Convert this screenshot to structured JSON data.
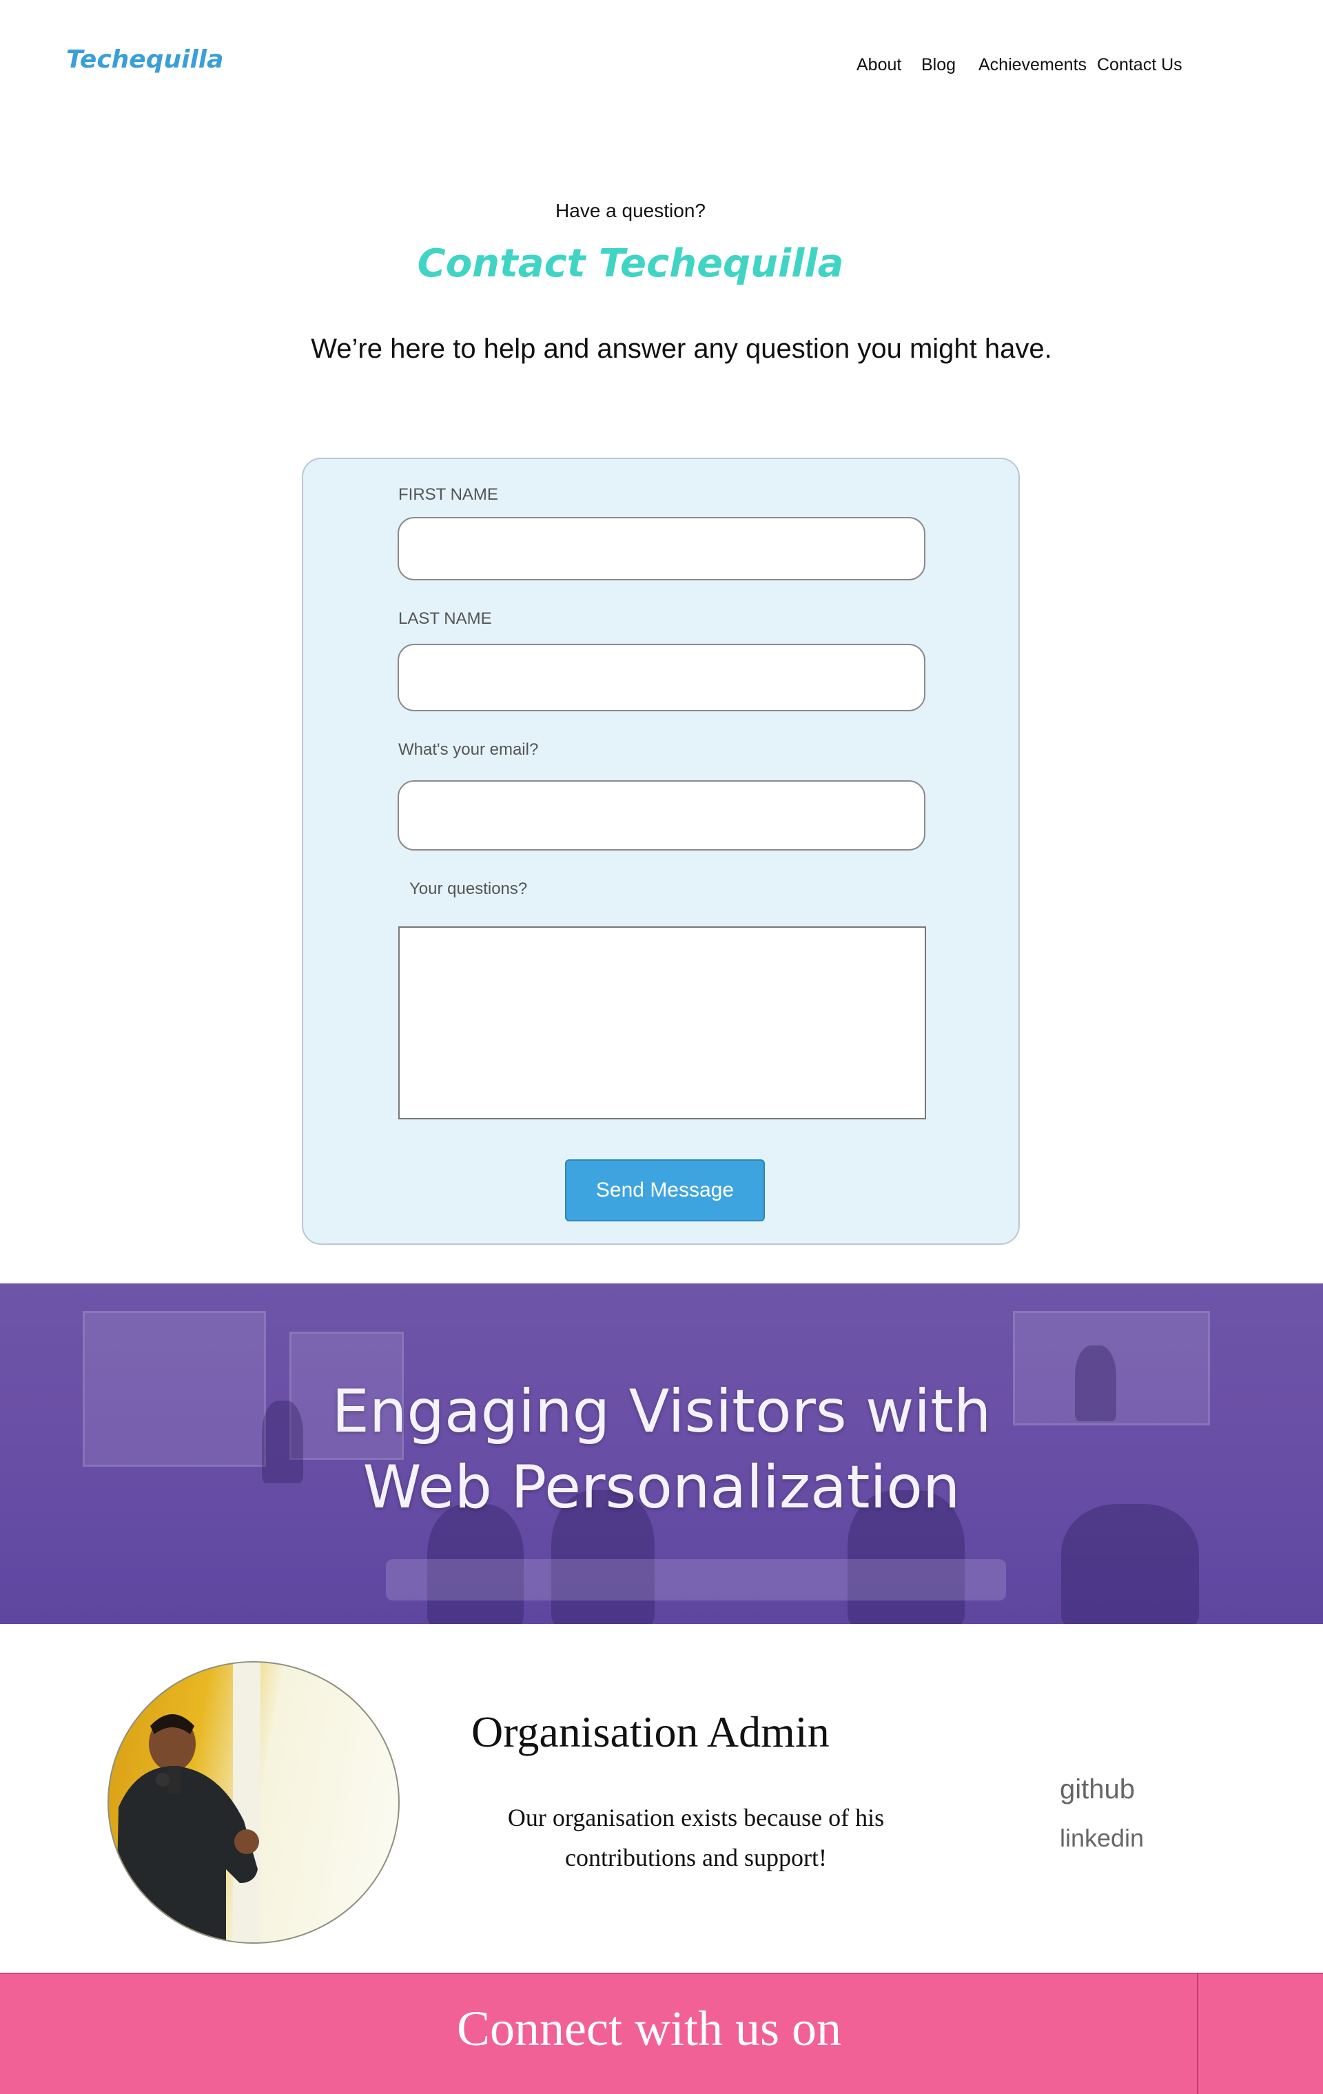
{
  "brand": "Techequilla",
  "nav": {
    "items": [
      "About",
      "Blog",
      "Achievements",
      "Contact Us"
    ]
  },
  "hero": {
    "eyebrow": "Have a question?",
    "title": "Contact Techequilla",
    "subtitle": "We’re here to help and answer any question you might have."
  },
  "form": {
    "first_name_label": "FIRST NAME",
    "first_name_value": "",
    "last_name_label": "LAST NAME",
    "last_name_value": "",
    "email_label": "What's your email?",
    "email_value": "",
    "questions_label": "Your questions?",
    "questions_value": "",
    "send_label": "Send Message"
  },
  "banner": {
    "line1": "Engaging Visitors with",
    "line2": "Web Personalization"
  },
  "admin": {
    "title": "Organisation Admin",
    "description": "Our organisation exists because of his contributions and support!",
    "links": [
      "github",
      "linkedin"
    ]
  },
  "footer": {
    "text": "Connect with us on"
  },
  "colors": {
    "brand": "#3a9fd8",
    "title": "#3fd4c4",
    "card_bg": "#e4f3fa",
    "button": "#3ea4df",
    "banner": "#6a4fa6",
    "footer": "#f26196"
  }
}
